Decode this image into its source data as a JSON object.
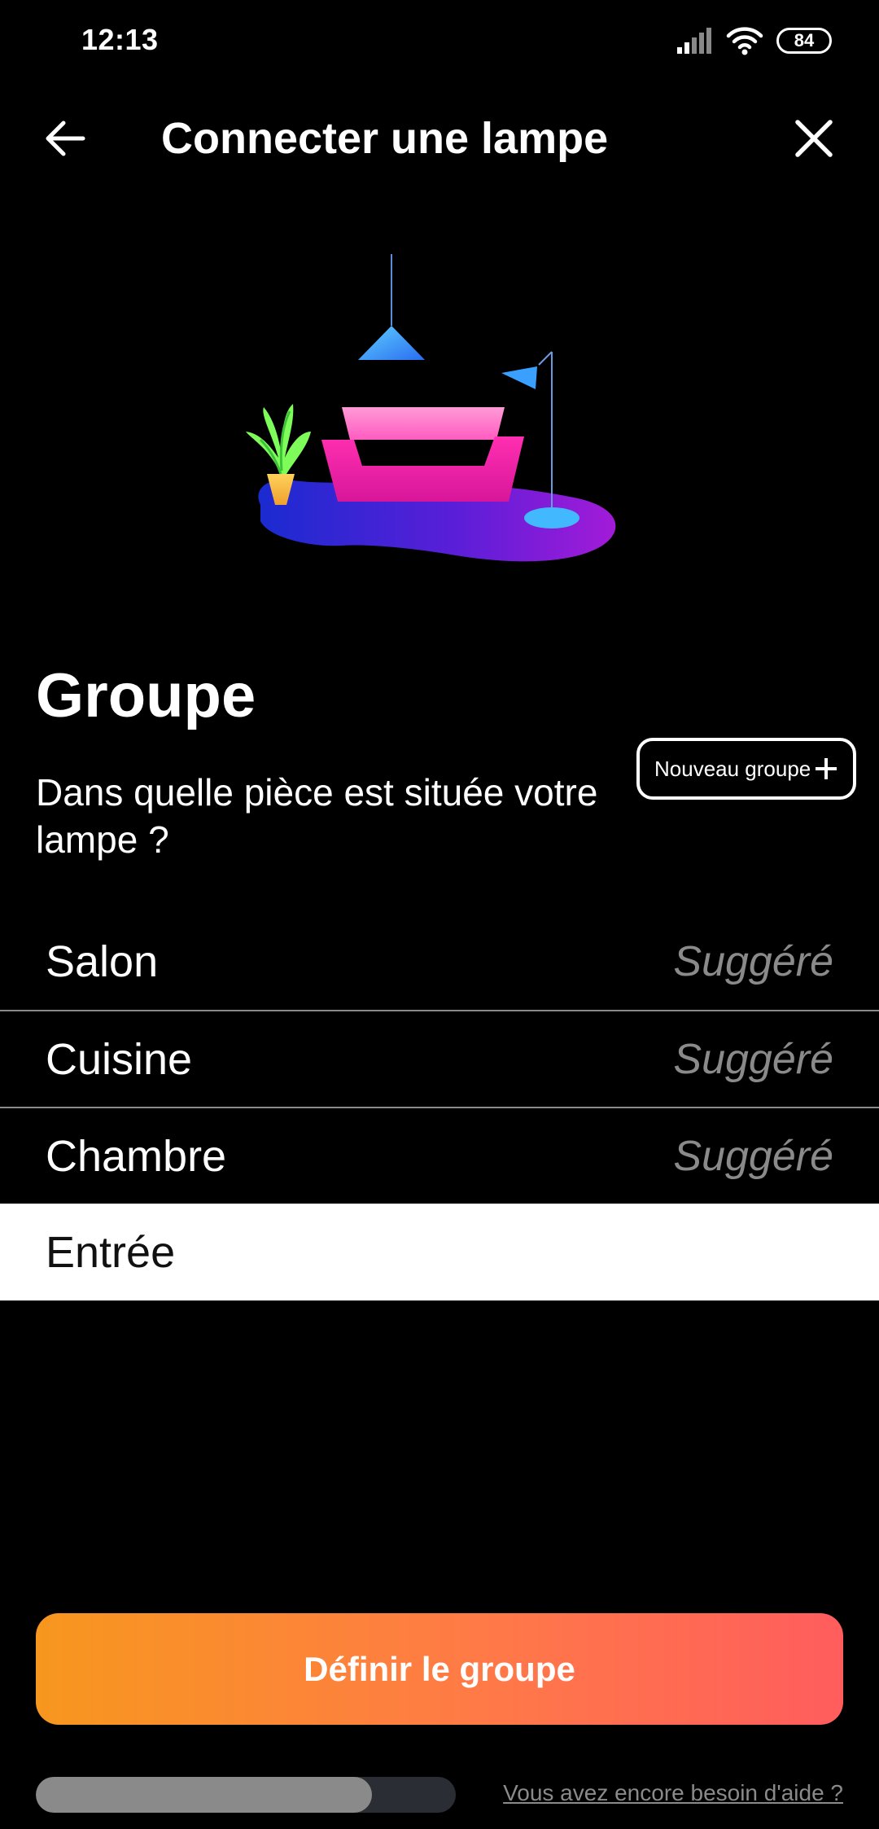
{
  "status_bar": {
    "time": "12:13",
    "battery": "84",
    "icons": [
      "signal-icon",
      "wifi-icon",
      "battery-icon"
    ]
  },
  "header": {
    "title": "Connecter une lampe",
    "back_icon": "arrow-left-icon",
    "close_icon": "close-icon"
  },
  "section": {
    "title": "Groupe",
    "question": "Dans quelle pièce est située votre lampe ?",
    "new_group_label": "Nouveau groupe",
    "new_group_icon": "plus-icon"
  },
  "rooms": [
    {
      "label": "Salon",
      "tag": "Suggéré",
      "selected": false
    },
    {
      "label": "Cuisine",
      "tag": "Suggéré",
      "selected": false
    },
    {
      "label": "Chambre",
      "tag": "Suggéré",
      "selected": false
    },
    {
      "label": "Entrée",
      "tag": "",
      "selected": true
    }
  ],
  "footer": {
    "primary_button": "Définir le groupe",
    "help_link": "Vous avez encore besoin d'aide ?",
    "progress_fraction": 0.8
  },
  "colors": {
    "background": "#000000",
    "accent_start": "#f7971e",
    "accent_end": "#ff5d5d",
    "muted": "#8a8a8a"
  }
}
